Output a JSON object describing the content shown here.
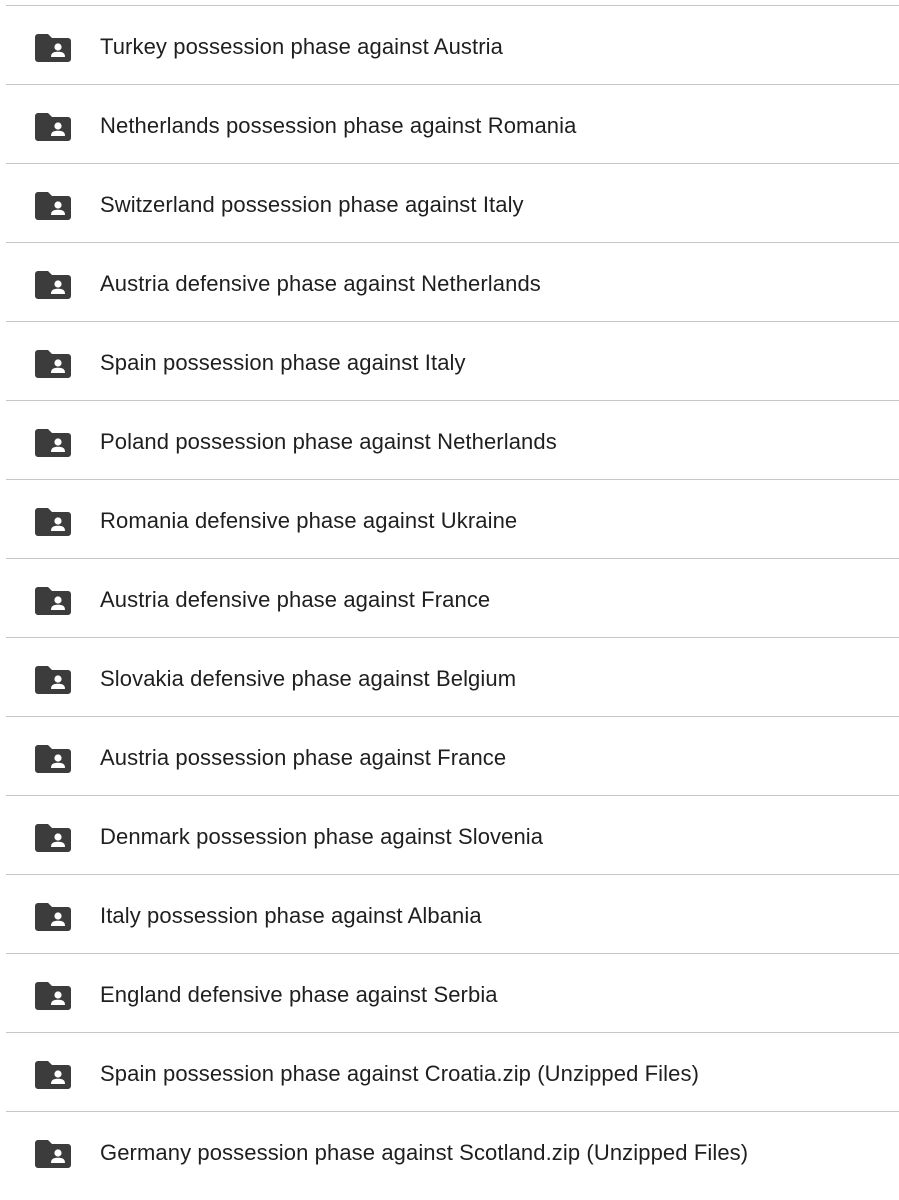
{
  "icon": "shared-folder-icon",
  "colors": {
    "icon": "#3c3c3c",
    "text": "#1f1f1f",
    "divider": "#c4c7c5"
  },
  "files": [
    {
      "name": "Turkey possession phase against Austria"
    },
    {
      "name": "Netherlands possession phase against Romania"
    },
    {
      "name": "Switzerland possession phase against Italy"
    },
    {
      "name": "Austria defensive phase against Netherlands"
    },
    {
      "name": "Spain possession phase against Italy"
    },
    {
      "name": "Poland possession phase against Netherlands"
    },
    {
      "name": "Romania defensive phase against Ukraine"
    },
    {
      "name": "Austria defensive phase against France"
    },
    {
      "name": "Slovakia defensive phase against Belgium"
    },
    {
      "name": "Austria possession phase against France"
    },
    {
      "name": "Denmark possession phase against Slovenia"
    },
    {
      "name": "Italy possession phase against Albania"
    },
    {
      "name": "England defensive phase against Serbia"
    },
    {
      "name": "Spain possession phase against Croatia.zip (Unzipped Files)"
    },
    {
      "name": "Germany possession phase against Scotland.zip (Unzipped Files)"
    }
  ]
}
